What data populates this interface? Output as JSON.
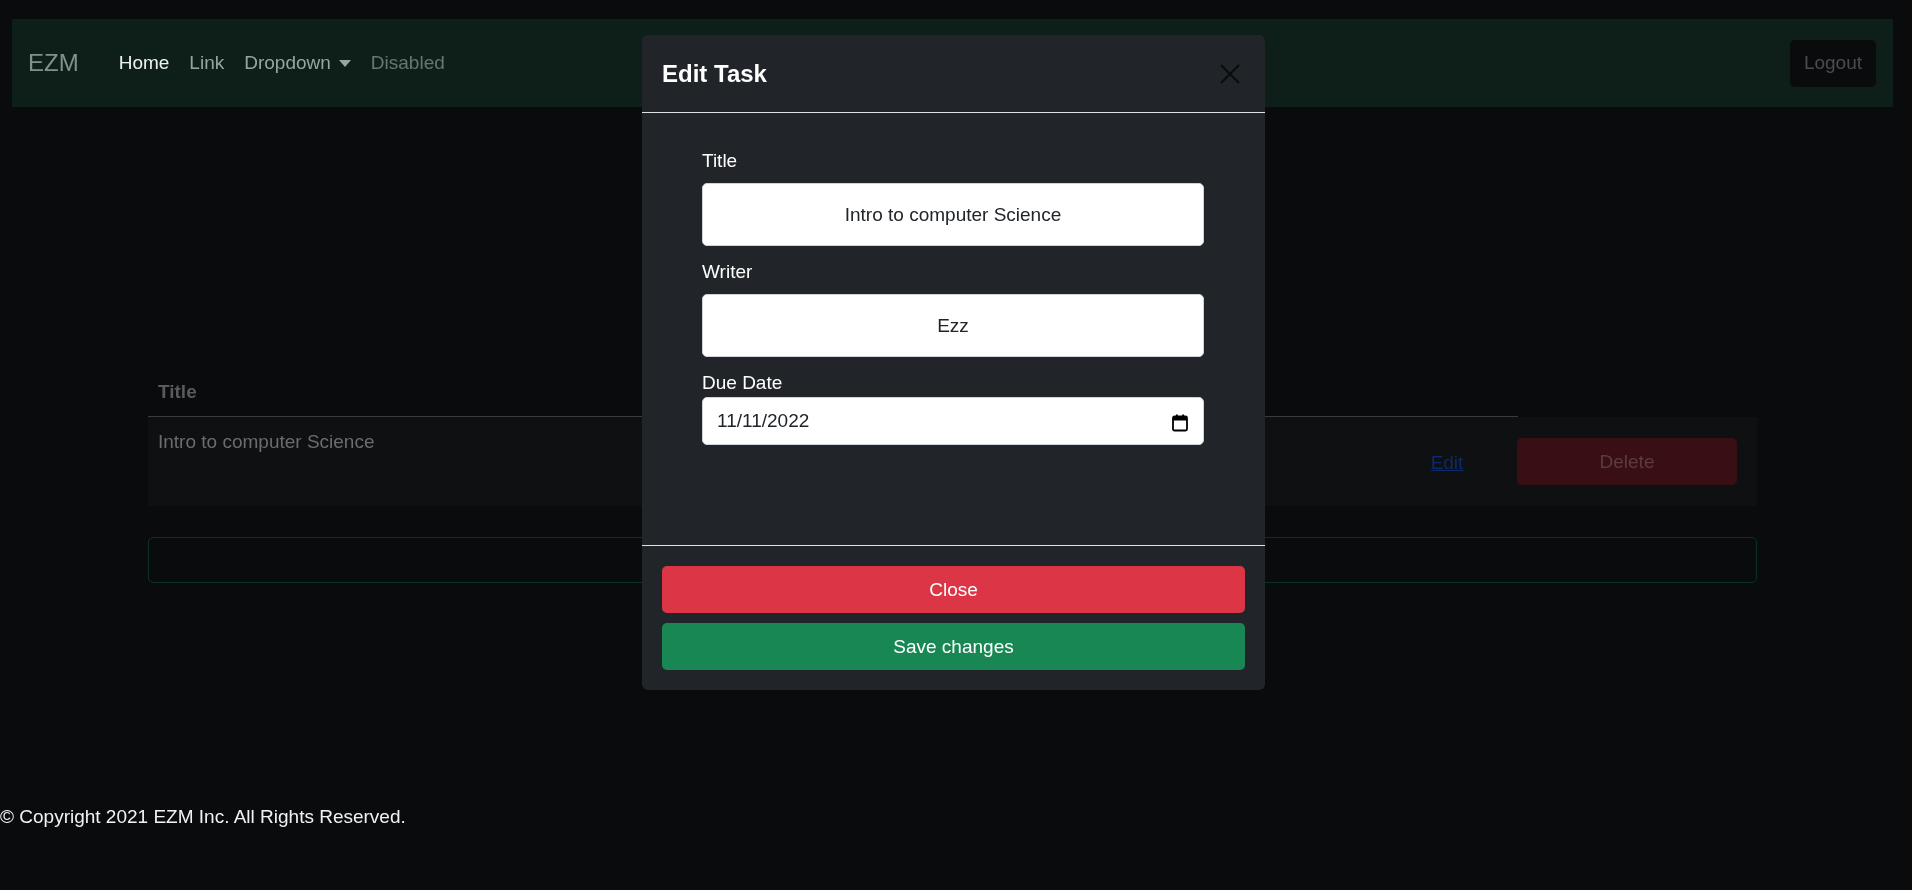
{
  "navbar": {
    "brand": "EZM",
    "items": [
      {
        "label": "Home",
        "selected": true,
        "disabled": false,
        "kind": "link"
      },
      {
        "label": "Link",
        "selected": false,
        "disabled": false,
        "kind": "link"
      },
      {
        "label": "Dropdown",
        "selected": false,
        "disabled": false,
        "kind": "dropdown"
      },
      {
        "label": "Disabled",
        "selected": false,
        "disabled": true,
        "kind": "link"
      }
    ],
    "logout": "Logout"
  },
  "table": {
    "columns": [
      "Title"
    ],
    "rows": [
      {
        "title": "Intro to computer Science",
        "edit": "Edit",
        "delete": "Delete"
      }
    ]
  },
  "modal": {
    "title": "Edit Task",
    "fields": [
      {
        "label": "Title",
        "value": "Intro to computer Science",
        "kind": "text"
      },
      {
        "label": "Writer",
        "value": "Ezz",
        "kind": "text"
      },
      {
        "label": "Due Date",
        "value": "11/11/2022",
        "kind": "date"
      }
    ],
    "buttons": [
      {
        "label": "Close",
        "kind": "danger"
      },
      {
        "label": "Save changes",
        "kind": "success"
      }
    ]
  },
  "footer": "© Copyright 2021 EZM Inc. All Rights Reserved."
}
